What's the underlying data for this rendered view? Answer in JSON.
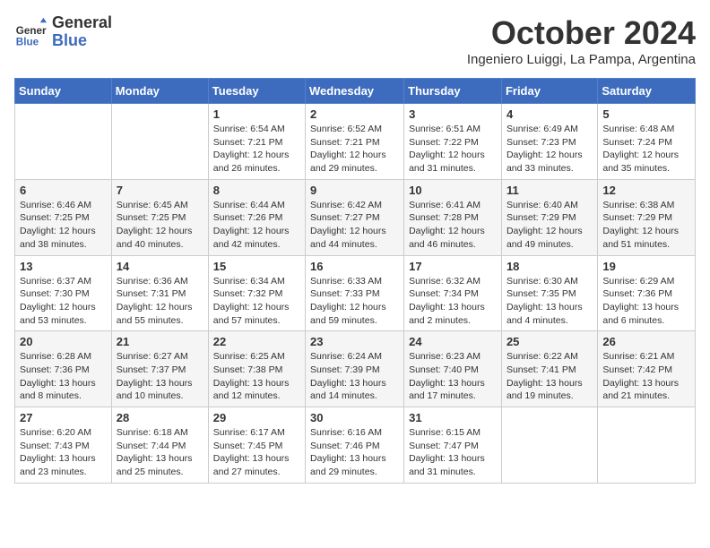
{
  "header": {
    "logo_line1": "General",
    "logo_line2": "Blue",
    "month": "October 2024",
    "location": "Ingeniero Luiggi, La Pampa, Argentina"
  },
  "weekdays": [
    "Sunday",
    "Monday",
    "Tuesday",
    "Wednesday",
    "Thursday",
    "Friday",
    "Saturday"
  ],
  "weeks": [
    [
      {
        "day": "",
        "text": ""
      },
      {
        "day": "",
        "text": ""
      },
      {
        "day": "1",
        "text": "Sunrise: 6:54 AM\nSunset: 7:21 PM\nDaylight: 12 hours\nand 26 minutes."
      },
      {
        "day": "2",
        "text": "Sunrise: 6:52 AM\nSunset: 7:21 PM\nDaylight: 12 hours\nand 29 minutes."
      },
      {
        "day": "3",
        "text": "Sunrise: 6:51 AM\nSunset: 7:22 PM\nDaylight: 12 hours\nand 31 minutes."
      },
      {
        "day": "4",
        "text": "Sunrise: 6:49 AM\nSunset: 7:23 PM\nDaylight: 12 hours\nand 33 minutes."
      },
      {
        "day": "5",
        "text": "Sunrise: 6:48 AM\nSunset: 7:24 PM\nDaylight: 12 hours\nand 35 minutes."
      }
    ],
    [
      {
        "day": "6",
        "text": "Sunrise: 6:46 AM\nSunset: 7:25 PM\nDaylight: 12 hours\nand 38 minutes."
      },
      {
        "day": "7",
        "text": "Sunrise: 6:45 AM\nSunset: 7:25 PM\nDaylight: 12 hours\nand 40 minutes."
      },
      {
        "day": "8",
        "text": "Sunrise: 6:44 AM\nSunset: 7:26 PM\nDaylight: 12 hours\nand 42 minutes."
      },
      {
        "day": "9",
        "text": "Sunrise: 6:42 AM\nSunset: 7:27 PM\nDaylight: 12 hours\nand 44 minutes."
      },
      {
        "day": "10",
        "text": "Sunrise: 6:41 AM\nSunset: 7:28 PM\nDaylight: 12 hours\nand 46 minutes."
      },
      {
        "day": "11",
        "text": "Sunrise: 6:40 AM\nSunset: 7:29 PM\nDaylight: 12 hours\nand 49 minutes."
      },
      {
        "day": "12",
        "text": "Sunrise: 6:38 AM\nSunset: 7:29 PM\nDaylight: 12 hours\nand 51 minutes."
      }
    ],
    [
      {
        "day": "13",
        "text": "Sunrise: 6:37 AM\nSunset: 7:30 PM\nDaylight: 12 hours\nand 53 minutes."
      },
      {
        "day": "14",
        "text": "Sunrise: 6:36 AM\nSunset: 7:31 PM\nDaylight: 12 hours\nand 55 minutes."
      },
      {
        "day": "15",
        "text": "Sunrise: 6:34 AM\nSunset: 7:32 PM\nDaylight: 12 hours\nand 57 minutes."
      },
      {
        "day": "16",
        "text": "Sunrise: 6:33 AM\nSunset: 7:33 PM\nDaylight: 12 hours\nand 59 minutes."
      },
      {
        "day": "17",
        "text": "Sunrise: 6:32 AM\nSunset: 7:34 PM\nDaylight: 13 hours\nand 2 minutes."
      },
      {
        "day": "18",
        "text": "Sunrise: 6:30 AM\nSunset: 7:35 PM\nDaylight: 13 hours\nand 4 minutes."
      },
      {
        "day": "19",
        "text": "Sunrise: 6:29 AM\nSunset: 7:36 PM\nDaylight: 13 hours\nand 6 minutes."
      }
    ],
    [
      {
        "day": "20",
        "text": "Sunrise: 6:28 AM\nSunset: 7:36 PM\nDaylight: 13 hours\nand 8 minutes."
      },
      {
        "day": "21",
        "text": "Sunrise: 6:27 AM\nSunset: 7:37 PM\nDaylight: 13 hours\nand 10 minutes."
      },
      {
        "day": "22",
        "text": "Sunrise: 6:25 AM\nSunset: 7:38 PM\nDaylight: 13 hours\nand 12 minutes."
      },
      {
        "day": "23",
        "text": "Sunrise: 6:24 AM\nSunset: 7:39 PM\nDaylight: 13 hours\nand 14 minutes."
      },
      {
        "day": "24",
        "text": "Sunrise: 6:23 AM\nSunset: 7:40 PM\nDaylight: 13 hours\nand 17 minutes."
      },
      {
        "day": "25",
        "text": "Sunrise: 6:22 AM\nSunset: 7:41 PM\nDaylight: 13 hours\nand 19 minutes."
      },
      {
        "day": "26",
        "text": "Sunrise: 6:21 AM\nSunset: 7:42 PM\nDaylight: 13 hours\nand 21 minutes."
      }
    ],
    [
      {
        "day": "27",
        "text": "Sunrise: 6:20 AM\nSunset: 7:43 PM\nDaylight: 13 hours\nand 23 minutes."
      },
      {
        "day": "28",
        "text": "Sunrise: 6:18 AM\nSunset: 7:44 PM\nDaylight: 13 hours\nand 25 minutes."
      },
      {
        "day": "29",
        "text": "Sunrise: 6:17 AM\nSunset: 7:45 PM\nDaylight: 13 hours\nand 27 minutes."
      },
      {
        "day": "30",
        "text": "Sunrise: 6:16 AM\nSunset: 7:46 PM\nDaylight: 13 hours\nand 29 minutes."
      },
      {
        "day": "31",
        "text": "Sunrise: 6:15 AM\nSunset: 7:47 PM\nDaylight: 13 hours\nand 31 minutes."
      },
      {
        "day": "",
        "text": ""
      },
      {
        "day": "",
        "text": ""
      }
    ]
  ]
}
